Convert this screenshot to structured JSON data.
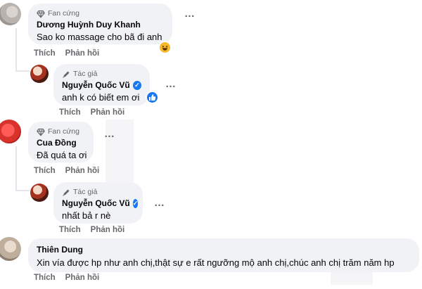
{
  "comments": [
    {
      "badge": "Fan cứng",
      "badge_icon": "diamond-icon",
      "name": "Dương Huỳnh Duy Khanh",
      "text": "Sao ko massage cho bã đi anh",
      "reaction_icon": "haha-reaction-icon",
      "actions": {
        "like": "Thích",
        "reply": "Phản hồi"
      }
    },
    {
      "badge": "Tác giả",
      "badge_icon": "pen-icon",
      "name": "Nguyễn Quốc Vũ",
      "verified": true,
      "text": "anh k có biết em ơi",
      "reaction_icon": "like-reaction-icon",
      "actions": {
        "like": "Thích",
        "reply": "Phản hồi"
      }
    },
    {
      "badge": "Fan cứng",
      "badge_icon": "diamond-icon",
      "name": "Cua Đồng",
      "text": "Đã quá ta ơi",
      "actions": {
        "like": "Thích",
        "reply": "Phản hồi"
      }
    },
    {
      "badge": "Tác giả",
      "badge_icon": "pen-icon",
      "name": "Nguyễn Quốc Vũ",
      "verified": true,
      "text": "nhất bả r nè",
      "actions": {
        "like": "Thích",
        "reply": "Phản hồi"
      }
    },
    {
      "name": "Thiên Dung",
      "text": "Xin vía được hp như anh chị,thật sự e rất ngưỡng mộ anh chị,chúc anh chị trăm năm hp",
      "actions": {
        "like": "Thích",
        "reply": "Phản hồi"
      }
    }
  ],
  "more_icon": "…",
  "verified_mark": "✓",
  "colors": {
    "bubble": "#f0f2f5",
    "muted": "#65676b",
    "verified": "#1877f2",
    "haha": "#f7b928"
  }
}
